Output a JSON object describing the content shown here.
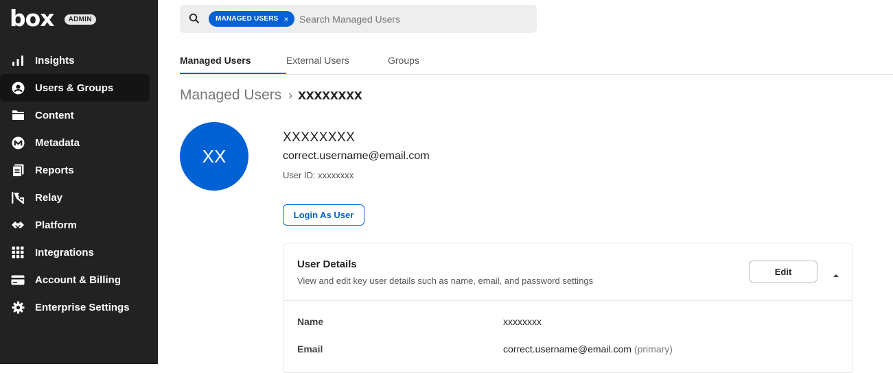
{
  "brand": {
    "logo_text": "box",
    "badge": "ADMIN"
  },
  "sidebar": {
    "items": [
      {
        "label": "Insights",
        "icon": "bar-chart-icon",
        "active": false
      },
      {
        "label": "Users & Groups",
        "icon": "user-circle-icon",
        "active": true
      },
      {
        "label": "Content",
        "icon": "folder-icon",
        "active": false
      },
      {
        "label": "Metadata",
        "icon": "metadata-icon",
        "active": false
      },
      {
        "label": "Reports",
        "icon": "reports-icon",
        "active": false
      },
      {
        "label": "Relay",
        "icon": "relay-icon",
        "active": false
      },
      {
        "label": "Platform",
        "icon": "platform-icon",
        "active": false
      },
      {
        "label": "Integrations",
        "icon": "grid-icon",
        "active": false
      },
      {
        "label": "Account & Billing",
        "icon": "credit-card-icon",
        "active": false
      },
      {
        "label": "Enterprise Settings",
        "icon": "gear-icon",
        "active": false
      }
    ]
  },
  "search": {
    "filter_pill": "MANAGED USERS",
    "pill_close": "×",
    "placeholder": "Search Managed Users",
    "value": ""
  },
  "tabs": [
    {
      "label": "Managed Users",
      "active": true
    },
    {
      "label": "External Users",
      "active": false
    },
    {
      "label": "Groups",
      "active": false
    }
  ],
  "breadcrumb": {
    "root": "Managed Users",
    "separator": "›",
    "current": "xxxxxxxx"
  },
  "user": {
    "initials": "XX",
    "name": "XXXXXXXX",
    "email": "correct.username@email.com",
    "user_id": "User ID: xxxxxxxx",
    "login_button": "Login As User"
  },
  "user_details": {
    "title": "User Details",
    "subtitle": "View and edit key user details such as name, email, and password settings",
    "edit_button": "Edit",
    "rows": [
      {
        "label": "Name",
        "value": "xxxxxxxx",
        "note": ""
      },
      {
        "label": "Email",
        "value": "correct.username@email.com",
        "note": "(primary)"
      }
    ]
  },
  "colors": {
    "sidebar_bg": "#222222",
    "accent": "#0061d5",
    "active_item_bg": "#141414"
  }
}
